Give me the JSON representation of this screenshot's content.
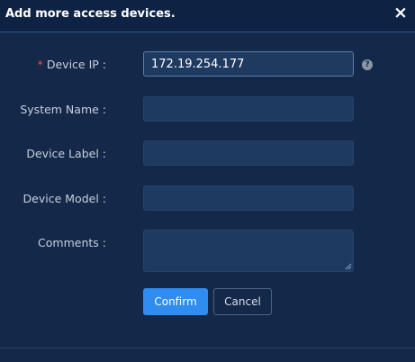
{
  "dialog": {
    "title": "Add more access devices.",
    "close_icon": "×"
  },
  "form": {
    "device_ip": {
      "label": "Device IP :",
      "required_mark": "*",
      "value": "172.19.254.177",
      "help_icon": "?"
    },
    "system_name": {
      "label": "System Name :",
      "value": ""
    },
    "device_label": {
      "label": "Device Label :",
      "value": ""
    },
    "device_model": {
      "label": "Device Model :",
      "value": ""
    },
    "comments": {
      "label": "Comments :",
      "value": ""
    }
  },
  "buttons": {
    "confirm": "Confirm",
    "cancel": "Cancel"
  },
  "colors": {
    "background": "#14284a",
    "accent": "#2f8cf0",
    "required": "#f04848"
  }
}
